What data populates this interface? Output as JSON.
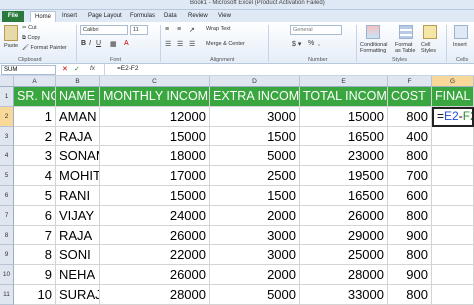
{
  "window": {
    "title": "Book1 - Microsoft Excel (Product Activation Failed)"
  },
  "tabs": [
    {
      "label": "File"
    },
    {
      "label": "Home"
    },
    {
      "label": "Insert"
    },
    {
      "label": "Page Layout"
    },
    {
      "label": "Formulas"
    },
    {
      "label": "Data"
    },
    {
      "label": "Review"
    },
    {
      "label": "View"
    }
  ],
  "ribbon": {
    "cut": "Cut",
    "copy": "Copy",
    "format_painter": "Format Painter",
    "paste": "Paste",
    "font_name": "Calibri",
    "font_size": "11",
    "wrap_text": "Wrap Text",
    "merge_center": "Merge & Center",
    "number_format": "General",
    "conditional_formatting": "Conditional Formatting",
    "format_as_table": "Format as Table",
    "cell_styles": "Cell Styles",
    "insert": "Insert",
    "groups": {
      "clipboard": "Clipboard",
      "font": "Font",
      "alignment": "Alignment",
      "number": "Number",
      "styles": "Styles",
      "cells": "Cells"
    }
  },
  "formula_bar": {
    "name_box": "SUM",
    "fx": "fx",
    "formula": "=E2-F2"
  },
  "columns": [
    "A",
    "B",
    "C",
    "D",
    "E",
    "F",
    "G"
  ],
  "headers": [
    "SR. NO.",
    "NAME",
    "MONTHLY INCOME",
    "EXTRA INCOME",
    "TOTAL INCOME",
    "COST",
    "FINAL"
  ],
  "rows": [
    {
      "rownum": "2",
      "sr": "1",
      "name": "AMAN",
      "monthly": "12000",
      "extra": "3000",
      "total": "15000",
      "cost": "800"
    },
    {
      "rownum": "3",
      "sr": "2",
      "name": "RAJA",
      "monthly": "15000",
      "extra": "1500",
      "total": "16500",
      "cost": "400"
    },
    {
      "rownum": "4",
      "sr": "3",
      "name": "SONAM",
      "monthly": "18000",
      "extra": "5000",
      "total": "23000",
      "cost": "800"
    },
    {
      "rownum": "5",
      "sr": "4",
      "name": "MOHIT",
      "monthly": "17000",
      "extra": "2500",
      "total": "19500",
      "cost": "700"
    },
    {
      "rownum": "6",
      "sr": "5",
      "name": "RANI",
      "monthly": "15000",
      "extra": "1500",
      "total": "16500",
      "cost": "600"
    },
    {
      "rownum": "7",
      "sr": "6",
      "name": "VIJAY",
      "monthly": "24000",
      "extra": "2000",
      "total": "26000",
      "cost": "800"
    },
    {
      "rownum": "8",
      "sr": "7",
      "name": "RAJA",
      "monthly": "26000",
      "extra": "3000",
      "total": "29000",
      "cost": "900"
    },
    {
      "rownum": "9",
      "sr": "8",
      "name": "SONI",
      "monthly": "22000",
      "extra": "3000",
      "total": "25000",
      "cost": "800"
    },
    {
      "rownum": "10",
      "sr": "9",
      "name": "NEHA",
      "monthly": "26000",
      "extra": "2000",
      "total": "28000",
      "cost": "900"
    },
    {
      "rownum": "11",
      "sr": "10",
      "name": "SURAJ",
      "monthly": "28000",
      "extra": "5000",
      "total": "33000",
      "cost": "800"
    }
  ],
  "header_rownum": "1",
  "active_cell": {
    "prefix": "=",
    "ref1": "E2",
    "op": "-",
    "ref2": "F2"
  },
  "colors": {
    "header_fill": "#3aa63f",
    "file_tab": "#2a7a3b",
    "ref_e": "#1f4fd6",
    "ref_f": "#2e8b2e"
  }
}
